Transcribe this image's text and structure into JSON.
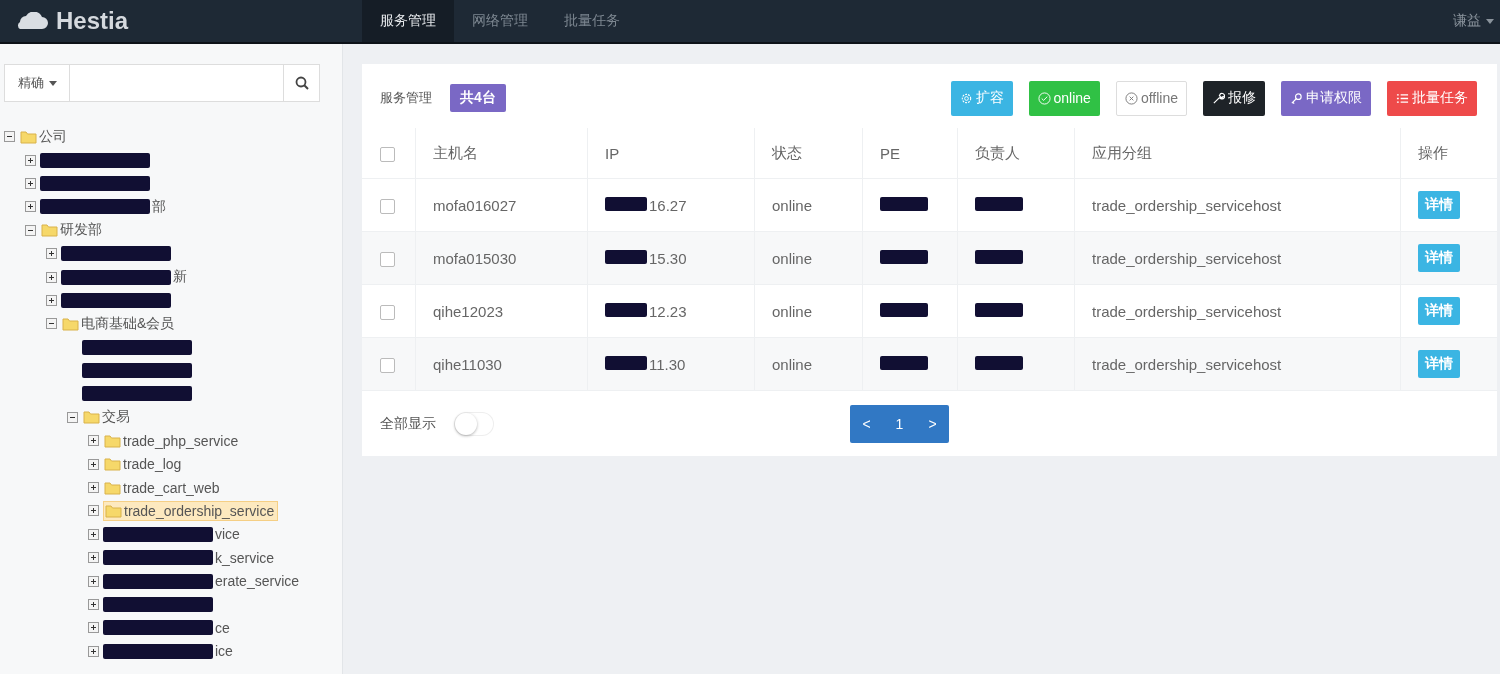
{
  "navbar": {
    "brand": "Hestia",
    "tabs": [
      {
        "label": "服务管理",
        "selected": true
      },
      {
        "label": "网络管理",
        "selected": false
      },
      {
        "label": "批量任务",
        "selected": false
      }
    ],
    "user": "谦益"
  },
  "sidebar": {
    "search": {
      "mode": "精确"
    },
    "tree": [
      {
        "label": "公司",
        "expanded": true,
        "selected": false,
        "children": [
          {
            "redacted": true,
            "expanded": false
          },
          {
            "redacted": true,
            "expanded": false
          },
          {
            "redacted": true,
            "tail": "部",
            "expanded": false
          },
          {
            "label": "研发部",
            "expanded": true,
            "selected": false,
            "children": [
              {
                "redacted": true,
                "expanded": false
              },
              {
                "redacted": true,
                "tail": "新",
                "expanded": false
              },
              {
                "redacted": true,
                "expanded": false
              },
              {
                "label": "电商基础&会员",
                "expanded": true,
                "selected": false,
                "children": [
                  {
                    "redacted": true
                  },
                  {
                    "redacted": true
                  },
                  {
                    "redacted": true
                  },
                  {
                    "label": "交易",
                    "expanded": true,
                    "selected": false,
                    "children": [
                      {
                        "label": "trade_php_service",
                        "expanded": false,
                        "selected": false
                      },
                      {
                        "label": "trade_log",
                        "expanded": false,
                        "selected": false
                      },
                      {
                        "label": "trade_cart_web",
                        "expanded": false,
                        "selected": false
                      },
                      {
                        "label": "trade_ordership_service",
                        "expanded": false,
                        "selected": true
                      },
                      {
                        "redacted": true,
                        "tail": "vice",
                        "expanded": false
                      },
                      {
                        "redacted": true,
                        "tail": "k_service",
                        "expanded": false
                      },
                      {
                        "redacted": true,
                        "tail": "erate_service",
                        "expanded": false
                      },
                      {
                        "redacted": true,
                        "expanded": false
                      },
                      {
                        "redacted": true,
                        "tail": "ce",
                        "expanded": false
                      },
                      {
                        "redacted": true,
                        "tail": "ice",
                        "expanded": false
                      }
                    ]
                  }
                ]
              }
            ]
          }
        ]
      }
    ]
  },
  "panel": {
    "title": "服务管理",
    "count": "共4台",
    "actions": [
      {
        "label": "扩容"
      },
      {
        "label": "online"
      },
      {
        "label": "offline"
      },
      {
        "label": "报修"
      },
      {
        "label": "申请权限"
      },
      {
        "label": "批量任务"
      }
    ],
    "table": {
      "select_all_checked": false,
      "columns": [
        "主机名",
        "IP",
        "状态",
        "PE",
        "负责人",
        "应用分组",
        "操作"
      ],
      "rows": [
        {
          "checked": false,
          "host": "mofa016027",
          "ip": "16.27",
          "status": "online",
          "pe_redacted": true,
          "owner_redacted": true,
          "group": "trade_ordership_servicehost",
          "action": "详情"
        },
        {
          "checked": false,
          "host": "mofa015030",
          "ip": "15.30",
          "status": "online",
          "pe_redacted": true,
          "owner_redacted": true,
          "group": "trade_ordership_servicehost",
          "action": "详情"
        },
        {
          "checked": false,
          "host": "qihe12023",
          "ip": "12.23",
          "status": "online",
          "pe_redacted": true,
          "owner_redacted": true,
          "group": "trade_ordership_servicehost",
          "action": "详情"
        },
        {
          "checked": false,
          "host": "qihe11030",
          "ip": "11.30",
          "status": "online",
          "pe_redacted": true,
          "owner_redacted": true,
          "group": "trade_ordership_servicehost",
          "action": "详情"
        }
      ]
    },
    "show_all": {
      "label": "全部显示",
      "on": false
    },
    "pagination": {
      "prev": "<",
      "page": "1",
      "next": ">"
    }
  }
}
